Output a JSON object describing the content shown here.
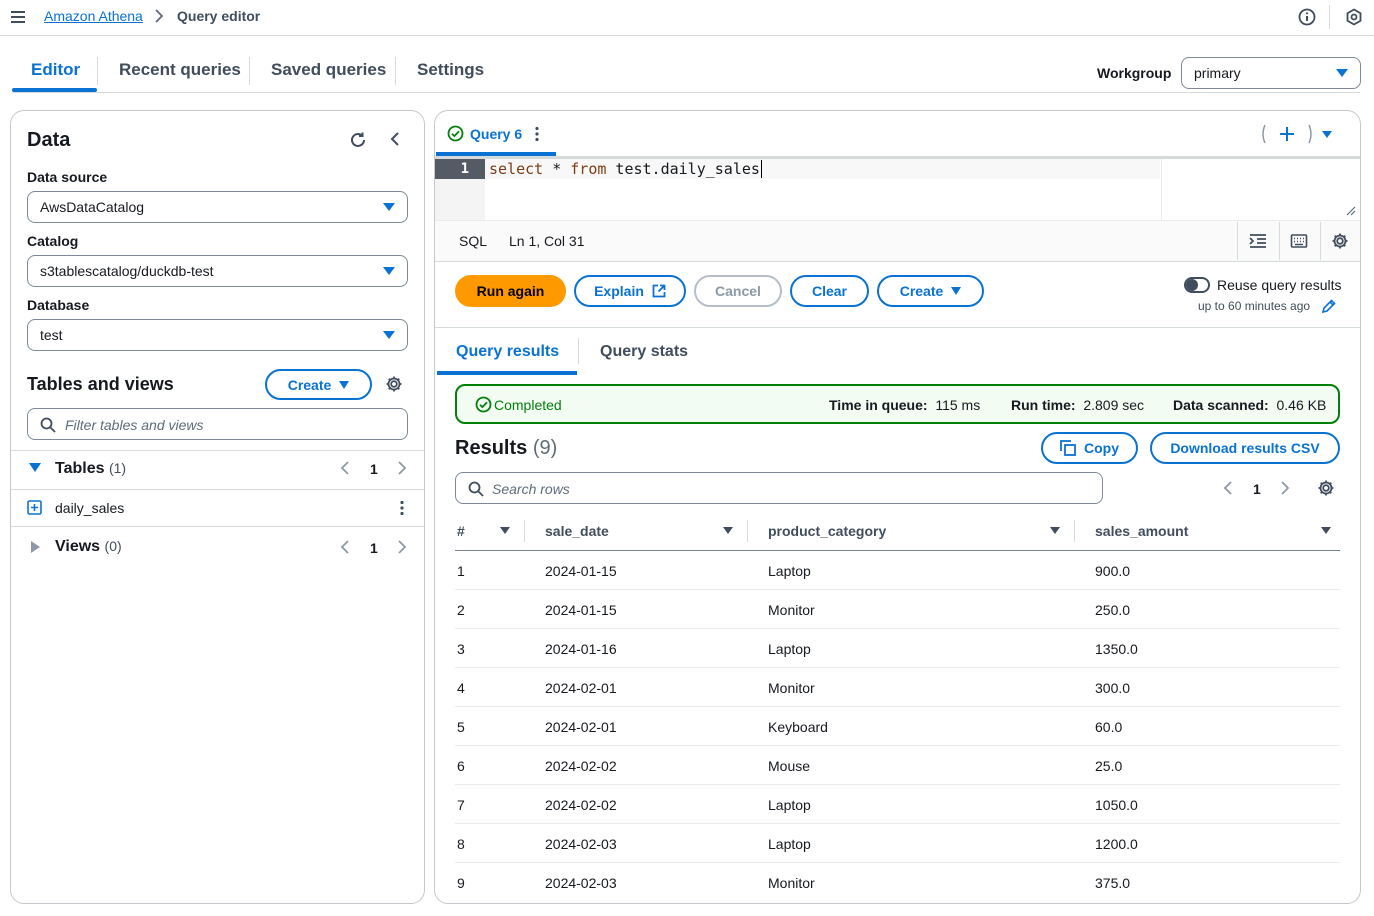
{
  "breadcrumb": {
    "root": "Amazon Athena",
    "current": "Query editor"
  },
  "main_tabs": [
    "Editor",
    "Recent queries",
    "Saved queries",
    "Settings"
  ],
  "workgroup": {
    "label": "Workgroup",
    "value": "primary"
  },
  "left": {
    "title": "Data",
    "data_source": {
      "label": "Data source",
      "value": "AwsDataCatalog"
    },
    "catalog": {
      "label": "Catalog",
      "value": "s3tablescatalog/duckdb-test"
    },
    "database": {
      "label": "Database",
      "value": "test"
    },
    "tables_views_title": "Tables and views",
    "create_label": "Create",
    "filter_placeholder": "Filter tables and views",
    "tables": {
      "label": "Tables",
      "count": "(1)",
      "page": "1",
      "items": [
        "daily_sales"
      ]
    },
    "views": {
      "label": "Views",
      "count": "(0)",
      "page": "1"
    }
  },
  "editor": {
    "query_tab": "Query 6",
    "line_number": "1",
    "code": {
      "kw1": "select",
      "op": " * ",
      "kw2": "from",
      "rest": " test.daily_sales"
    },
    "language": "SQL",
    "cursor": "Ln 1, Col 31"
  },
  "actions": {
    "run": "Run again",
    "explain": "Explain",
    "cancel": "Cancel",
    "clear": "Clear",
    "create": "Create",
    "reuse_label": "Reuse query results",
    "reuse_sub": "up to 60 minutes ago"
  },
  "results_tabs": {
    "results": "Query results",
    "stats": "Query stats"
  },
  "status": {
    "state": "Completed",
    "queue_label": "Time in queue:",
    "queue_value": "115 ms",
    "run_label": "Run time:",
    "run_value": "2.809 sec",
    "scanned_label": "Data scanned:",
    "scanned_value": "0.46 KB"
  },
  "results": {
    "title": "Results",
    "count": "(9)",
    "copy": "Copy",
    "download": "Download results CSV",
    "search_placeholder": "Search rows",
    "page": "1",
    "columns": [
      "#",
      "sale_date",
      "product_category",
      "sales_amount"
    ],
    "rows": [
      [
        "1",
        "2024-01-15",
        "Laptop",
        "900.0"
      ],
      [
        "2",
        "2024-01-15",
        "Monitor",
        "250.0"
      ],
      [
        "3",
        "2024-01-16",
        "Laptop",
        "1350.0"
      ],
      [
        "4",
        "2024-02-01",
        "Monitor",
        "300.0"
      ],
      [
        "5",
        "2024-02-01",
        "Keyboard",
        "60.0"
      ],
      [
        "6",
        "2024-02-02",
        "Mouse",
        "25.0"
      ],
      [
        "7",
        "2024-02-02",
        "Laptop",
        "1050.0"
      ],
      [
        "8",
        "2024-02-03",
        "Laptop",
        "1200.0"
      ],
      [
        "9",
        "2024-02-03",
        "Monitor",
        "375.0"
      ]
    ]
  },
  "colors": {
    "accent": "#0972d3",
    "run": "#ff9900",
    "success": "#037f0c"
  }
}
